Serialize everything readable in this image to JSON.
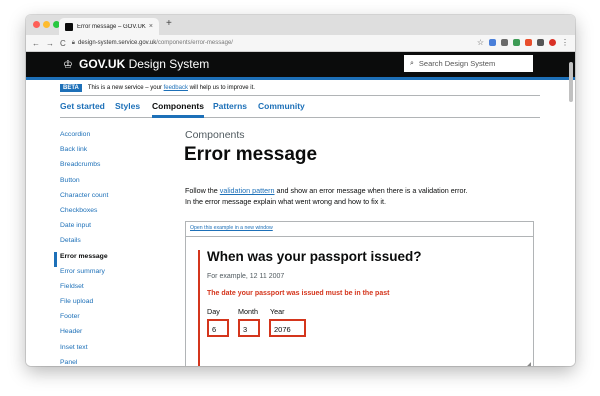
{
  "browser": {
    "tab_title": "Error message – GOV.UK Desig",
    "tab_close": "×",
    "new_tab": "+",
    "back": "←",
    "forward": "→",
    "reload": "C",
    "url_host": "design-system.service.gov.uk",
    "url_path": "/components/error-message/",
    "bookmark_icon": "☆",
    "extension_colors": [
      "#4a7fd9",
      "#6a6a6a",
      "#3d9b55",
      "#e84e2c",
      "#555555",
      "#d93025"
    ]
  },
  "header": {
    "brand": "GOV.UK",
    "product": "Design System",
    "search_placeholder": "Search Design System",
    "crown_icon": "crown-icon",
    "search_icon": "search-icon"
  },
  "beta": {
    "tag": "BETA",
    "text_before": "This is a new service – your ",
    "link": "feedback",
    "text_after": " will help us to improve it."
  },
  "topnav": {
    "items": [
      "Get started",
      "Styles",
      "Components",
      "Patterns",
      "Community"
    ],
    "active": "Components"
  },
  "sidenav": {
    "items": [
      "Accordion",
      "Back link",
      "Breadcrumbs",
      "Button",
      "Character count",
      "Checkboxes",
      "Date input",
      "Details",
      "Error message",
      "Error summary",
      "Fieldset",
      "File upload",
      "Footer",
      "Header",
      "Inset text",
      "Panel"
    ],
    "current": "Error message"
  },
  "main": {
    "caption": "Components",
    "heading": "Error message",
    "intro_1": "Follow the ",
    "intro_link": "validation pattern",
    "intro_2": " and show an error message when there is a validation error.",
    "intro_3": "In the error message explain what went wrong and how to fix it."
  },
  "example": {
    "open_link": "Open this example in a new window",
    "question": "When was your passport issued?",
    "hint": "For example, 12 11 2007",
    "error": "The date your passport was issued must be in the past",
    "fields": [
      {
        "label": "Day",
        "value": "6"
      },
      {
        "label": "Month",
        "value": "3"
      },
      {
        "label": "Year",
        "value": "2076"
      }
    ]
  },
  "colors": {
    "govuk_black": "#0b0c0c",
    "govuk_blue": "#1d70b8",
    "error_red": "#d4351c",
    "secondary_text": "#505a5f"
  }
}
